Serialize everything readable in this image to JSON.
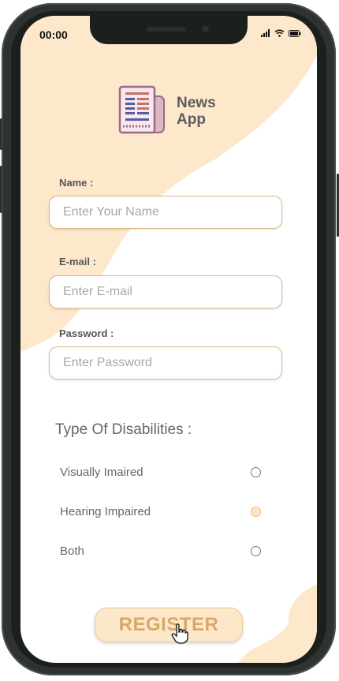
{
  "status_bar": {
    "time": "00:00"
  },
  "app": {
    "title": "News\nApp"
  },
  "form": {
    "name": {
      "label": "Name :",
      "placeholder": "Enter Your Name"
    },
    "email": {
      "label": "E-mail :",
      "placeholder": "Enter E-mail"
    },
    "password": {
      "label": "Password :",
      "placeholder": "Enter Password"
    }
  },
  "disabilities": {
    "title": "Type Of Disabilities :",
    "options": [
      {
        "label": "Visually Imaired",
        "selected": false
      },
      {
        "label": "Hearing Impaired",
        "selected": true
      },
      {
        "label": "Both",
        "selected": false
      }
    ]
  },
  "register": {
    "label": "REGISTER"
  },
  "colors": {
    "accent": "#fde7c9",
    "border": "#d9b98a",
    "register_text": "#d8a86a",
    "logo": "#b07a9a"
  }
}
